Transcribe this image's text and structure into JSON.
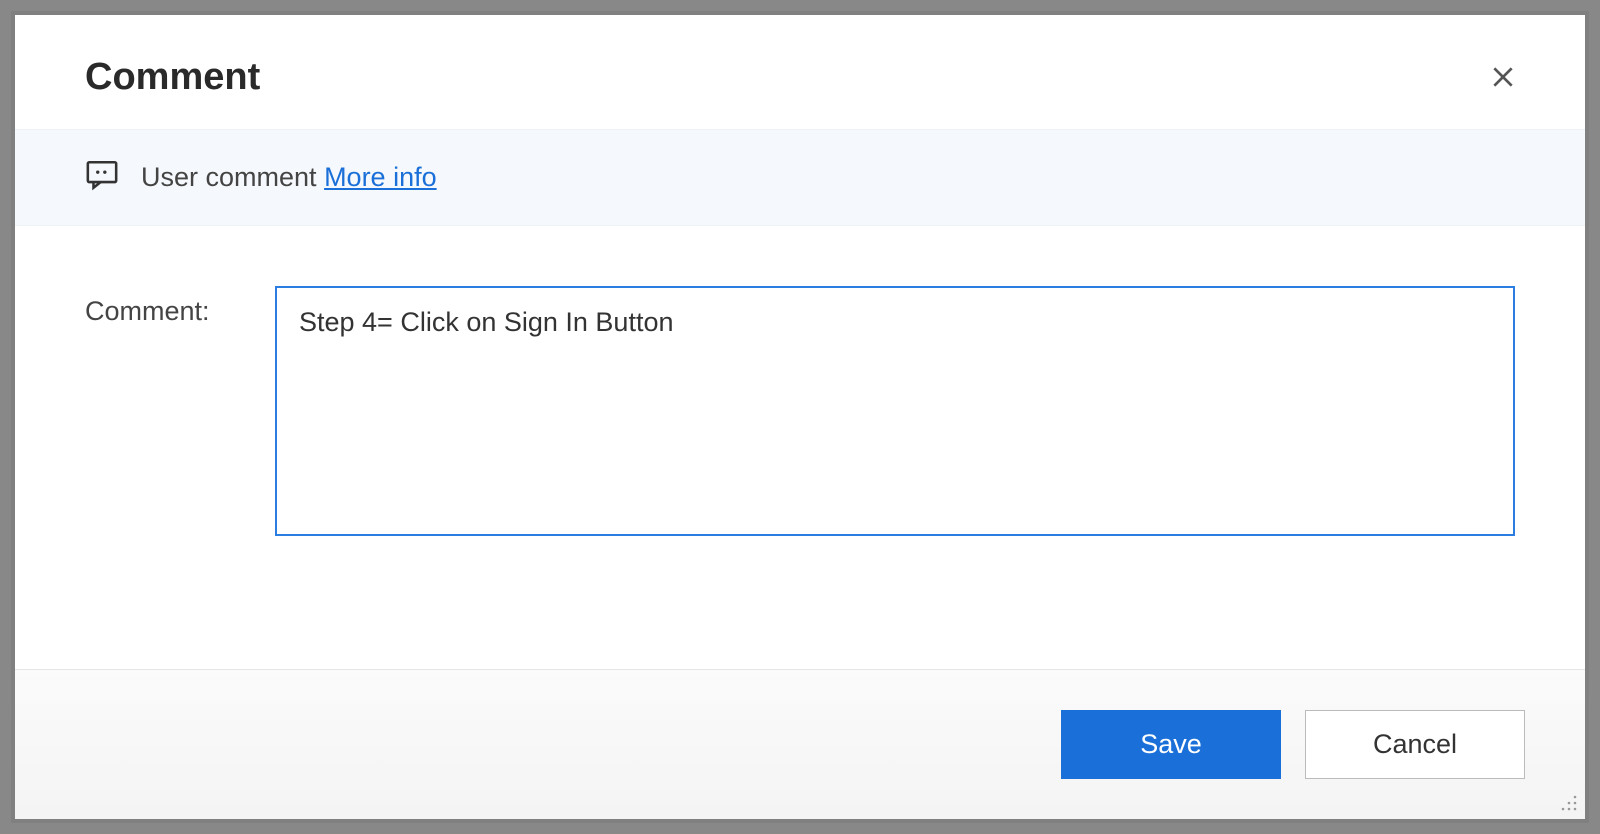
{
  "dialog": {
    "title": "Comment",
    "banner_text": "User comment",
    "more_info_label": "More info",
    "field_label": "Comment:",
    "comment_value": "Step 4= Click on Sign In Button",
    "save_label": "Save",
    "cancel_label": "Cancel"
  }
}
